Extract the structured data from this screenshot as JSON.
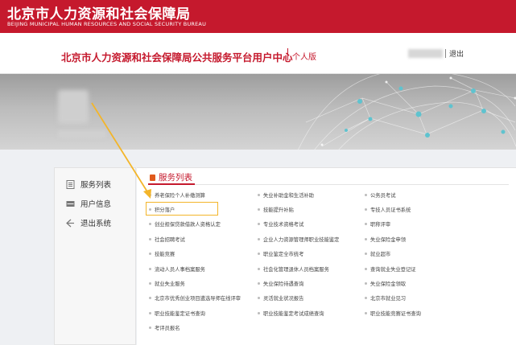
{
  "header": {
    "bureau_name_cn": "北京市人力资源和社会保障局",
    "bureau_name_en": "BEIJING MUNICIPAL HUMAN RESOURCES AND SOCIAL SECURITY BUREAU",
    "brand_color": "#c5192d"
  },
  "subheader": {
    "platform_title": "北京市人力资源和社会保障局公共服务平台用户中心",
    "edition": "个人版",
    "logout": "退出"
  },
  "sidebar": {
    "items": [
      {
        "label": "服务列表",
        "icon": "list-icon"
      },
      {
        "label": "用户信息",
        "icon": "user-card-icon"
      },
      {
        "label": "退出系统",
        "icon": "exit-icon"
      }
    ]
  },
  "main": {
    "tab_title": "服务列表",
    "highlight_color": "#f3b52a",
    "services": [
      [
        "养老保险个人补缴测算",
        "失业补助金和生活补助",
        "公务员考试"
      ],
      [
        "积分落户",
        "技能提升补贴",
        "专技人员证书系统"
      ],
      [
        "创业担保贷款借款人资格认定",
        "专业技术资格考试",
        "职称评审"
      ],
      [
        "社会招聘考试",
        "企业人力资源管理师职业技能鉴定",
        "失业保险金申领"
      ],
      [
        "技能竞赛",
        "职业鉴定全市统考",
        "就业超市"
      ],
      [
        "流动人员人事档案服务",
        "社会化管理退休人员档案服务",
        "查询就业失业登记证"
      ],
      [
        "就业失业服务",
        "失业保险待遇查询",
        "失业保险金领取"
      ],
      [
        "北京市优秀创业项目遴选导师在线评审",
        "灵活就业状况报告",
        "北京市就业见习"
      ],
      [
        "职业技能鉴定证书查询",
        "职业技能鉴定考试成绩查询",
        "职业技能竞赛证书查询"
      ],
      [
        "考评员报名"
      ]
    ]
  }
}
